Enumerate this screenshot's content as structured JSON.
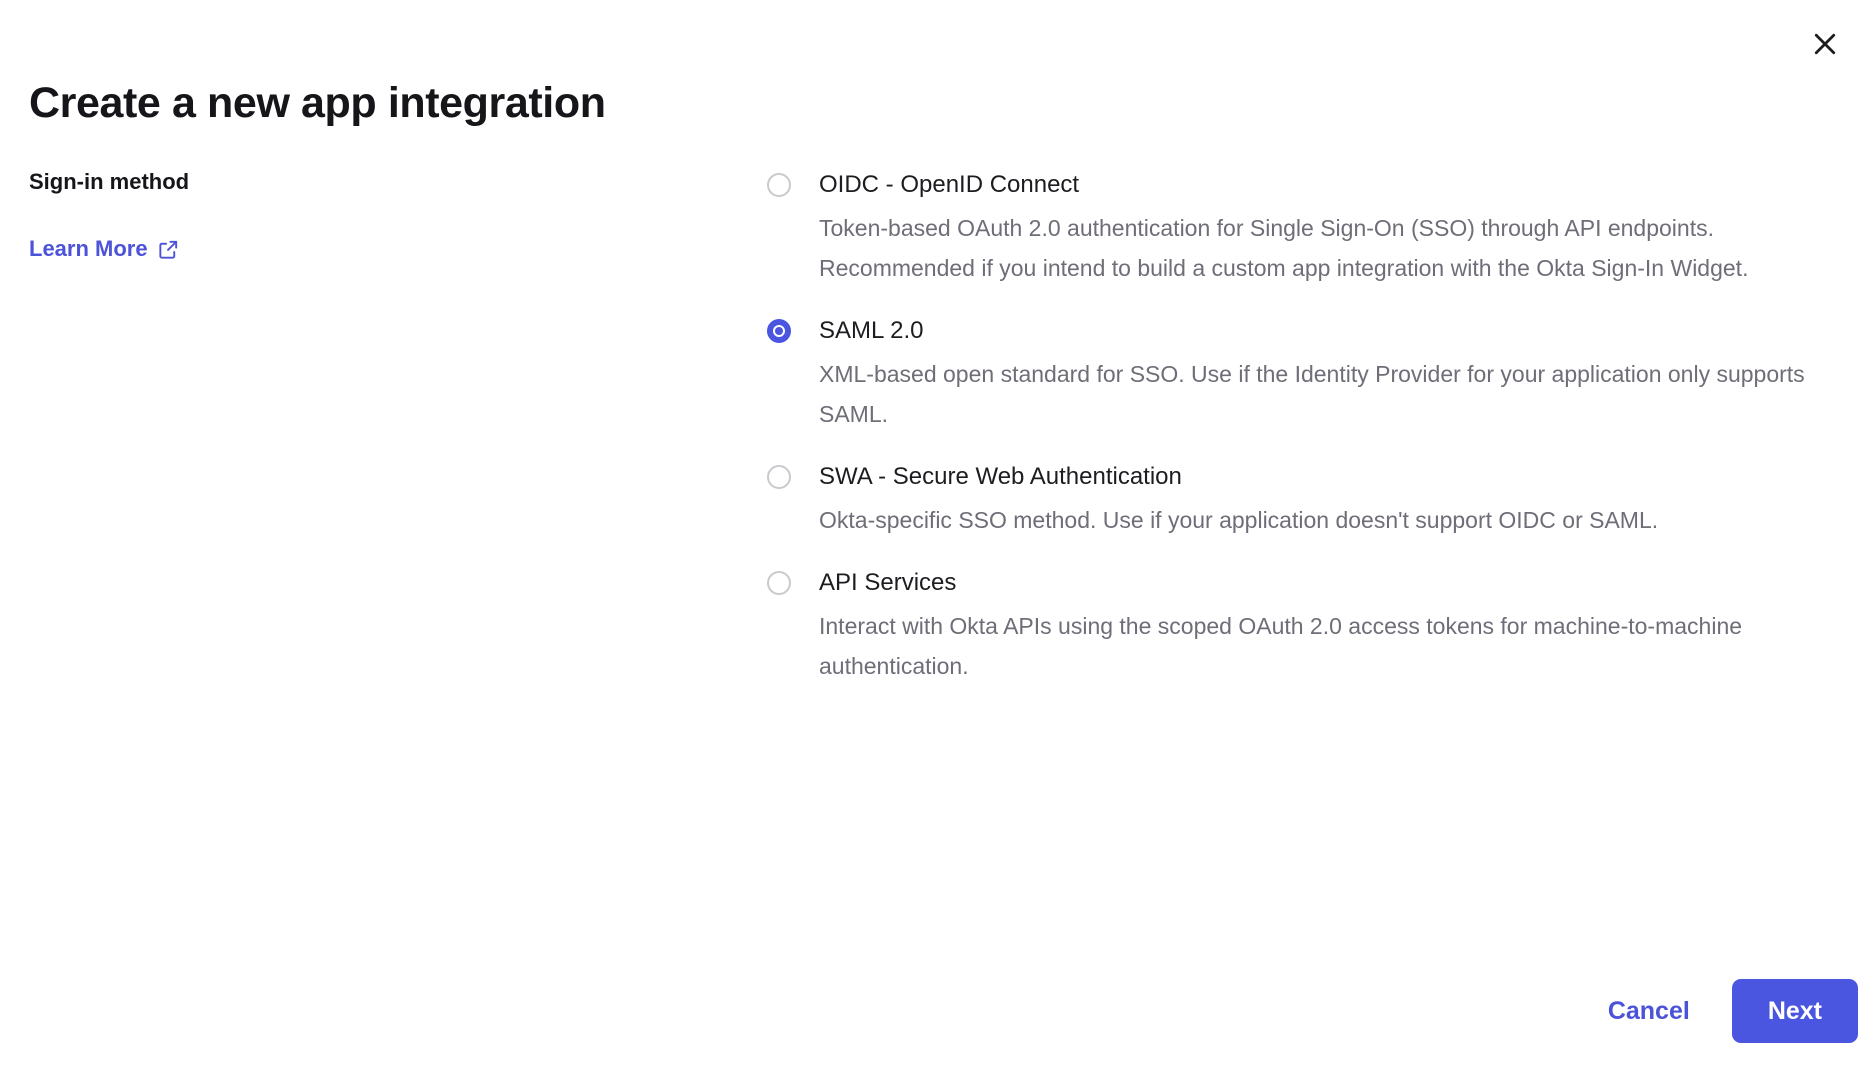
{
  "dialog": {
    "title": "Create a new app integration",
    "close_icon": "close-icon",
    "close_label": "Close"
  },
  "sidebar": {
    "section_label": "Sign-in method",
    "learn_more_label": "Learn More",
    "learn_more_icon": "external-link-icon"
  },
  "sign_in_methods": {
    "selected": "SAML 2.0",
    "options": [
      {
        "title": "OIDC - OpenID Connect",
        "description": "Token-based OAuth 2.0 authentication for Single Sign-On (SSO) through API endpoints. Recommended if you intend to build a custom app integration with the Okta Sign-In Widget.",
        "selected": false
      },
      {
        "title": "SAML 2.0",
        "description": "XML-based open standard for SSO. Use if the Identity Provider for your application only supports SAML.",
        "selected": true
      },
      {
        "title": "SWA - Secure Web Authentication",
        "description": "Okta-specific SSO method. Use if your application doesn't support OIDC or SAML.",
        "selected": false
      },
      {
        "title": "API Services",
        "description": "Interact with Okta APIs using the scoped OAuth 2.0 access tokens for machine-to-machine authentication.",
        "selected": false
      }
    ]
  },
  "footer": {
    "cancel_label": "Cancel",
    "next_label": "Next"
  },
  "colors": {
    "accent": "#4a55e0",
    "link": "#4d53d9",
    "title_text": "#15151a",
    "option_title_text": "#1d1d21",
    "description_text": "#6e6e78",
    "radio_border": "#c9c9ce"
  }
}
